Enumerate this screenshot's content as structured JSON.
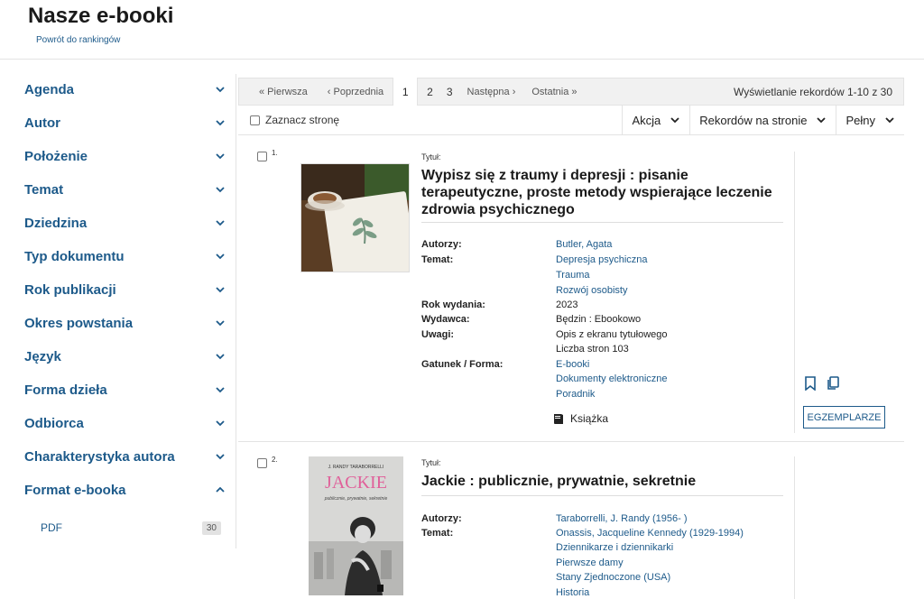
{
  "header": {
    "title": "Nasze e-booki",
    "back_link": "Powrót do rankingów"
  },
  "sidebar": {
    "facets": [
      {
        "label": "Agenda"
      },
      {
        "label": "Autor"
      },
      {
        "label": "Położenie"
      },
      {
        "label": "Temat"
      },
      {
        "label": "Dziedzina"
      },
      {
        "label": "Typ dokumentu"
      },
      {
        "label": "Rok publikacji"
      },
      {
        "label": "Okres powstania"
      },
      {
        "label": "Język"
      },
      {
        "label": "Forma dzieła"
      },
      {
        "label": "Odbiorca"
      },
      {
        "label": "Charakterystyka autora"
      },
      {
        "label": "Format e-booka",
        "expanded": true
      }
    ],
    "format_item": {
      "label": "PDF",
      "count": "30"
    }
  },
  "pager": {
    "first": "« Pierwsza",
    "prev": "‹ Poprzednia",
    "pages": [
      "1",
      "2",
      "3"
    ],
    "current": "1",
    "next": "Następna ›",
    "last": "Ostatnia »",
    "info": "Wyświetlanie rekordów 1-10 z 30"
  },
  "toolbar": {
    "select_page": "Zaznacz stronę",
    "action": "Akcja",
    "per_page": "Rekordów na stronie",
    "view": "Pełny"
  },
  "records": [
    {
      "no": "1.",
      "title_label": "Tytuł:",
      "title": "Wypisz się z traumy i depresji : pisanie terapeutyczne, proste metody wspierające leczenie zdrowia psychicznego",
      "authors_label": "Autorzy:",
      "authors": [
        "Butler, Agata"
      ],
      "subject_label": "Temat:",
      "subjects": [
        "Depresja psychiczna",
        "Trauma",
        "Rozwój osobisty"
      ],
      "year_label": "Rok wydania:",
      "year": "2023",
      "publisher_label": "Wydawca:",
      "publisher": "Będzin : Ebookowo",
      "notes_label": "Uwagi:",
      "notes": [
        "Opis z ekranu tytułowego",
        "Liczba stron 103"
      ],
      "genre_label": "Gatunek / Forma:",
      "genres": [
        "E-booki",
        "Dokumenty elektroniczne",
        "Poradnik"
      ],
      "type": "Książka",
      "copies_button": "EGZEMPLARZE"
    },
    {
      "no": "2.",
      "title_label": "Tytuł:",
      "title": "Jackie : publicznie, prywatnie, sekretnie",
      "authors_label": "Autorzy:",
      "authors": [
        "Taraborrelli, J. Randy (1956- )"
      ],
      "subject_label": "Temat:",
      "subjects": [
        "Onassis, Jacqueline Kennedy (1929-1994)",
        "Dziennikarze i dziennikarki",
        "Pierwsze damy",
        "Stany Zjednoczone (USA)",
        "Historia"
      ],
      "cover_author": "J. RANDY TARABORRELLI",
      "cover_title": "JACKIE",
      "cover_subtitle": "publicznie, prywatnie, sekretnie"
    }
  ],
  "colors": {
    "link": "#1d5a8a",
    "pager_bg": "#f1f1f1",
    "cover2_title": "#e0609a"
  }
}
